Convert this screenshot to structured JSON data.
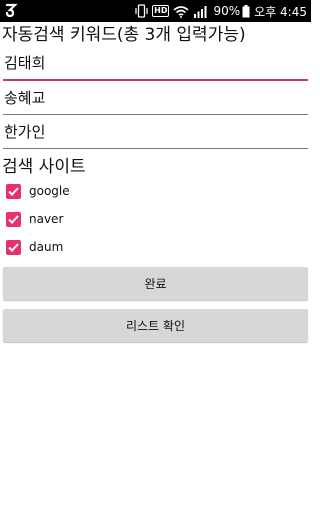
{
  "status_bar": {
    "battery": "90%",
    "time": "오후 4:45",
    "hd_label": "HD"
  },
  "keywords": {
    "title": "자동검색 키워드(총 3개 입력가능)",
    "fields": [
      "김태희",
      "송혜교",
      "한가인"
    ]
  },
  "sites": {
    "title": "검색 사이트",
    "items": [
      {
        "label": "google",
        "checked": true
      },
      {
        "label": "naver",
        "checked": true
      },
      {
        "label": "daum",
        "checked": true
      }
    ]
  },
  "buttons": {
    "done": "완료",
    "list": "리스트 확인"
  },
  "colors": {
    "accent": "#e8306f",
    "focus_line": "#c0397a",
    "button_bg": "#d7d7d7"
  }
}
